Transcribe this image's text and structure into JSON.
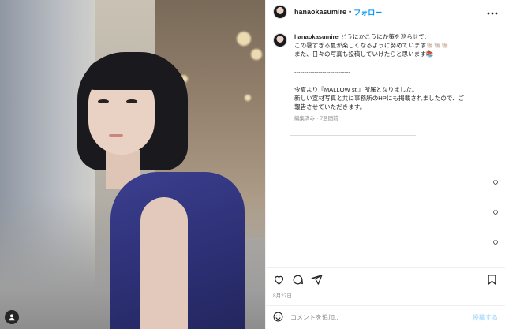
{
  "header": {
    "username": "hanaokasumire",
    "separator": "•",
    "follow_label": "フォロー",
    "more_icon": "more-horizontal-icon"
  },
  "caption": {
    "username": "hanaokasumire",
    "lines": [
      "どうにかこうにか策を巡らせて、",
      "この暑すぎる夏が楽しくなるように努めています🐚🐚🐚",
      "また、日々の写真も投稿していけたらと思います📚",
      "",
      "----------------------------",
      "",
      "今夏より『MALLOW st.』所属となりました。",
      "新しい宣材写真と共に事務所のHPにも掲載されましたので、ご",
      "報告させていただきます。"
    ],
    "meta": "編集済み・7週間前"
  },
  "actions": {
    "like_icon": "heart-icon",
    "comment_icon": "comment-icon",
    "share_icon": "paper-plane-icon",
    "save_icon": "bookmark-icon"
  },
  "date": "8月27日",
  "composer": {
    "emoji_icon": "smiley-icon",
    "placeholder": "コメントを追加...",
    "post_label": "投稿する"
  },
  "photo": {
    "tag_icon": "user-tag-icon"
  }
}
